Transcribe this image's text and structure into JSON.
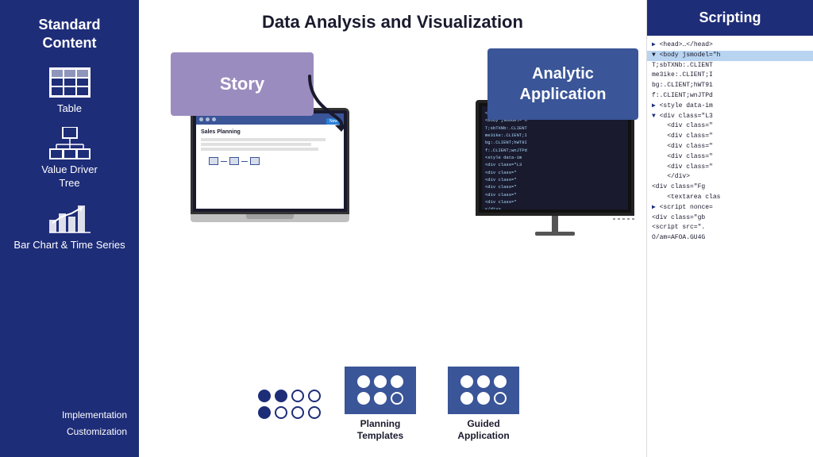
{
  "page": {
    "title": "Data Analysis and Visualization"
  },
  "sidebar": {
    "title": "Standard Content",
    "items": [
      {
        "label": "Table"
      },
      {
        "label": "Value Driver Tree"
      },
      {
        "label": "Bar Chart & Time Series"
      }
    ],
    "bottom": {
      "implementation": "Implementation",
      "customization": "Customization"
    }
  },
  "cards": {
    "story": "Story",
    "analytic": "Analytic Application"
  },
  "bottom_sections": [
    {
      "id": "planning",
      "label": "Planning Templates",
      "dots": [
        [
          true,
          true,
          true
        ],
        [
          true,
          true,
          false
        ]
      ]
    },
    {
      "id": "guided",
      "label": "Guided Application",
      "dots": [
        [
          true,
          true,
          true
        ],
        [
          true,
          true,
          false
        ]
      ]
    }
  ],
  "scripting": {
    "title": "Scripting",
    "code_lines": [
      "▶ <head>…</head>",
      "▼ <body jsmodel=\"h",
      "  T;sbTXNb:.CLIENT",
      "  me3ike:.CLIENT;I",
      "  bg:.CLIENT;hWT9I",
      "  f:.CLIENT;wnJTPd",
      "  ▶ <style data-im",
      "  ▼ <div class=\"L3",
      "    <div class=\"",
      "    <div class=\"",
      "    <div class=\"",
      "    <div class=\"",
      "    <div class=\"",
      "    </div>",
      "  <div class=\"Fg",
      "    <textarea clas",
      "  ▶ <script nonce=",
      "  <div class=\"gb",
      "  <script src=\".",
      "  O/am=AFOA.GU4G"
    ]
  },
  "laptop_screen": {
    "title": "Sales Planning"
  },
  "dots_left": {
    "row1": [
      true,
      true,
      true
    ],
    "row2": [
      true,
      false,
      false
    ]
  },
  "dots_planning": {
    "row1": [
      true,
      true,
      true
    ],
    "row2": [
      true,
      true,
      false
    ]
  },
  "dots_guided": {
    "row1": [
      true,
      true,
      true
    ],
    "row2": [
      true,
      true,
      false
    ]
  }
}
